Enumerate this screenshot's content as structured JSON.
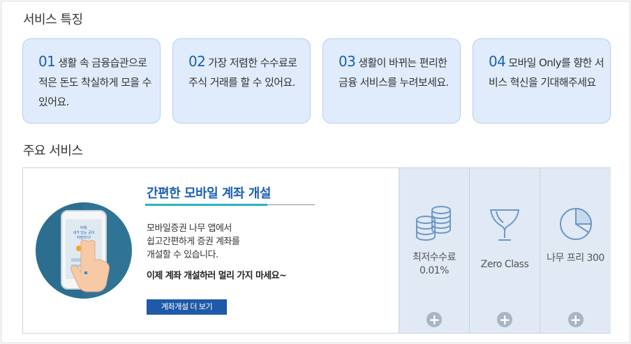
{
  "features_title": "서비스 특징",
  "features": [
    {
      "num": "01",
      "text": "생활 속 금융습관으로 적은 돈도 착실하게 모을 수 있어요."
    },
    {
      "num": "02",
      "text": "가장 저렴한 수수료로 주식 거래를 할 수 있어요."
    },
    {
      "num": "03",
      "text": "생활이 바뀌는 편리한 금융 서비스를 누려보세요."
    },
    {
      "num": "04",
      "text": "모바일 Only를 향한 서비스 혁신을 기대해주세요"
    }
  ],
  "services_title": "주요 서비스",
  "promo": {
    "title": "간편한 모바일 계좌 개설",
    "desc_lines": [
      "모바일증권 나무 앱에서",
      "쉽고간편하게 증권 계좌를",
      "개설할 수 있습니다."
    ],
    "strong": "이제 계좌 개설하러 멀리 가지 마세요~",
    "button": "계좌개설 더 보기",
    "phone_text": [
      "이제,",
      "내가 있는 곳이",
      "지점이다!"
    ]
  },
  "services": [
    {
      "label_lines": [
        "최저수수료",
        "0.01%"
      ],
      "icon": "coins-icon"
    },
    {
      "label_lines": [
        "Zero Class"
      ],
      "icon": "trophy-icon"
    },
    {
      "label_lines": [
        "나무 프리 300"
      ],
      "icon": "pie-chart-icon"
    }
  ],
  "colors": {
    "accent": "#1b5fb0",
    "card_bg": "#e0ecfb",
    "button": "#1e5aa8",
    "underline": "#27b4c0"
  }
}
